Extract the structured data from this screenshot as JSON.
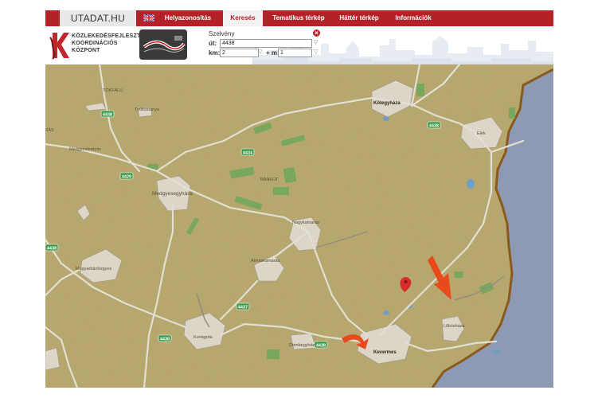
{
  "nav": {
    "brand": "UTADAT.HU",
    "items": [
      {
        "label": "Helyazonosítás"
      },
      {
        "label": "Keresés"
      },
      {
        "label": "Tematikus térkép"
      },
      {
        "label": "Háttér térkép"
      },
      {
        "label": "Információk"
      }
    ],
    "active_index": 1
  },
  "logo": {
    "line1": "KÖZLEKEDÉSFEJLESZTÉSI",
    "line2": "KOORDINÁCIÓS",
    "line3": "KÖZPONT"
  },
  "search": {
    "title": "Szelvény",
    "road_label": "út:",
    "road_value": "4438",
    "km_label": "km:",
    "km_value": "2",
    "m_label": "+ m:",
    "m_value": "1"
  },
  "map": {
    "roads": [
      "4438",
      "4434",
      "4429",
      "4438",
      "4438",
      "4438",
      "4437",
      "4438"
    ],
    "towns": {
      "tokfalu": "TÓKFALU",
      "tyukostanya": "Tyúkostanya",
      "kotegyhaza": "Kötegyháza",
      "elek": "Elek",
      "medgyesbodzas": "Medgyesbodzás",
      "medgyesegyhaza": "Medgyesegyháza",
      "bankut": "BÁNKÚT",
      "nagykamaras": "Nagykamarás",
      "almaskamaras": "Almáskamarás",
      "magyarbanhegyes": "Magyarbánhegyes",
      "kunagota": "Kunágota",
      "dombegyhaz": "Dombegyház",
      "kevermes": "Kevermes",
      "lokoshaza": "Lőkösháza",
      "edge_left": "ZÁS"
    },
    "colors": {
      "land": "#b9a96e",
      "water": "#8e99b3",
      "border": "#8a5a1d",
      "arrow": "#e84a1c",
      "pin": "#d92b2b",
      "shield": "#3a9a4a"
    }
  }
}
